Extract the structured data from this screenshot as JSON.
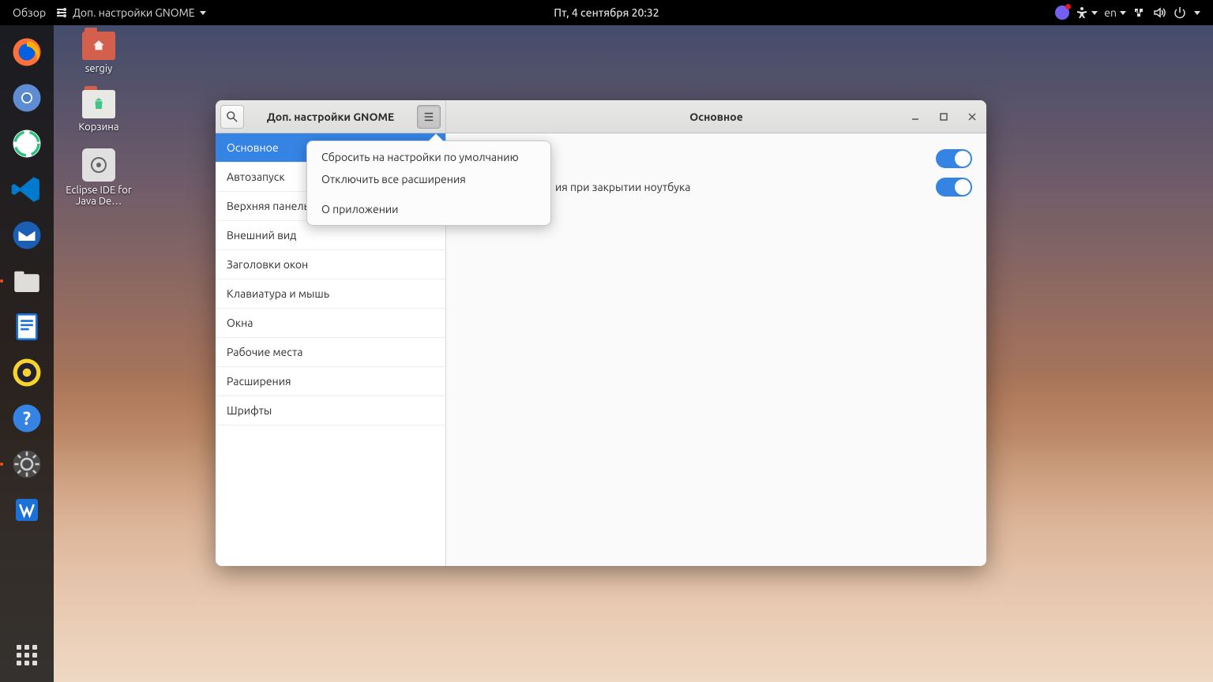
{
  "topbar": {
    "activities": "Обзор",
    "app_name": "Доп. настройки GNOME",
    "clock": "Пт, 4 сентября  20:32",
    "lang": "en"
  },
  "desktop": {
    "icons": [
      {
        "label": "sergiy",
        "type": "home"
      },
      {
        "label": "Корзина",
        "type": "trash"
      },
      {
        "label": "Eclipse IDE for Java De…",
        "type": "app"
      }
    ]
  },
  "window": {
    "left_title": "Доп. настройки GNOME",
    "right_title": "Основное",
    "sidebar": [
      "Основное",
      "Автозапуск",
      "Верхняя панель",
      "Внешний вид",
      "Заголовки окон",
      "Клавиатура и мышь",
      "Окна",
      "Рабочие места",
      "Расширения",
      "Шрифты"
    ],
    "content_rows": [
      {
        "label_partial": "ия при закрытии ноутбука",
        "on": true
      }
    ],
    "obscured_switch": {
      "on": true
    }
  },
  "popover": {
    "items": [
      "Сбросить на настройки по умолчанию",
      "Отключить все расширения",
      "О приложении"
    ]
  }
}
